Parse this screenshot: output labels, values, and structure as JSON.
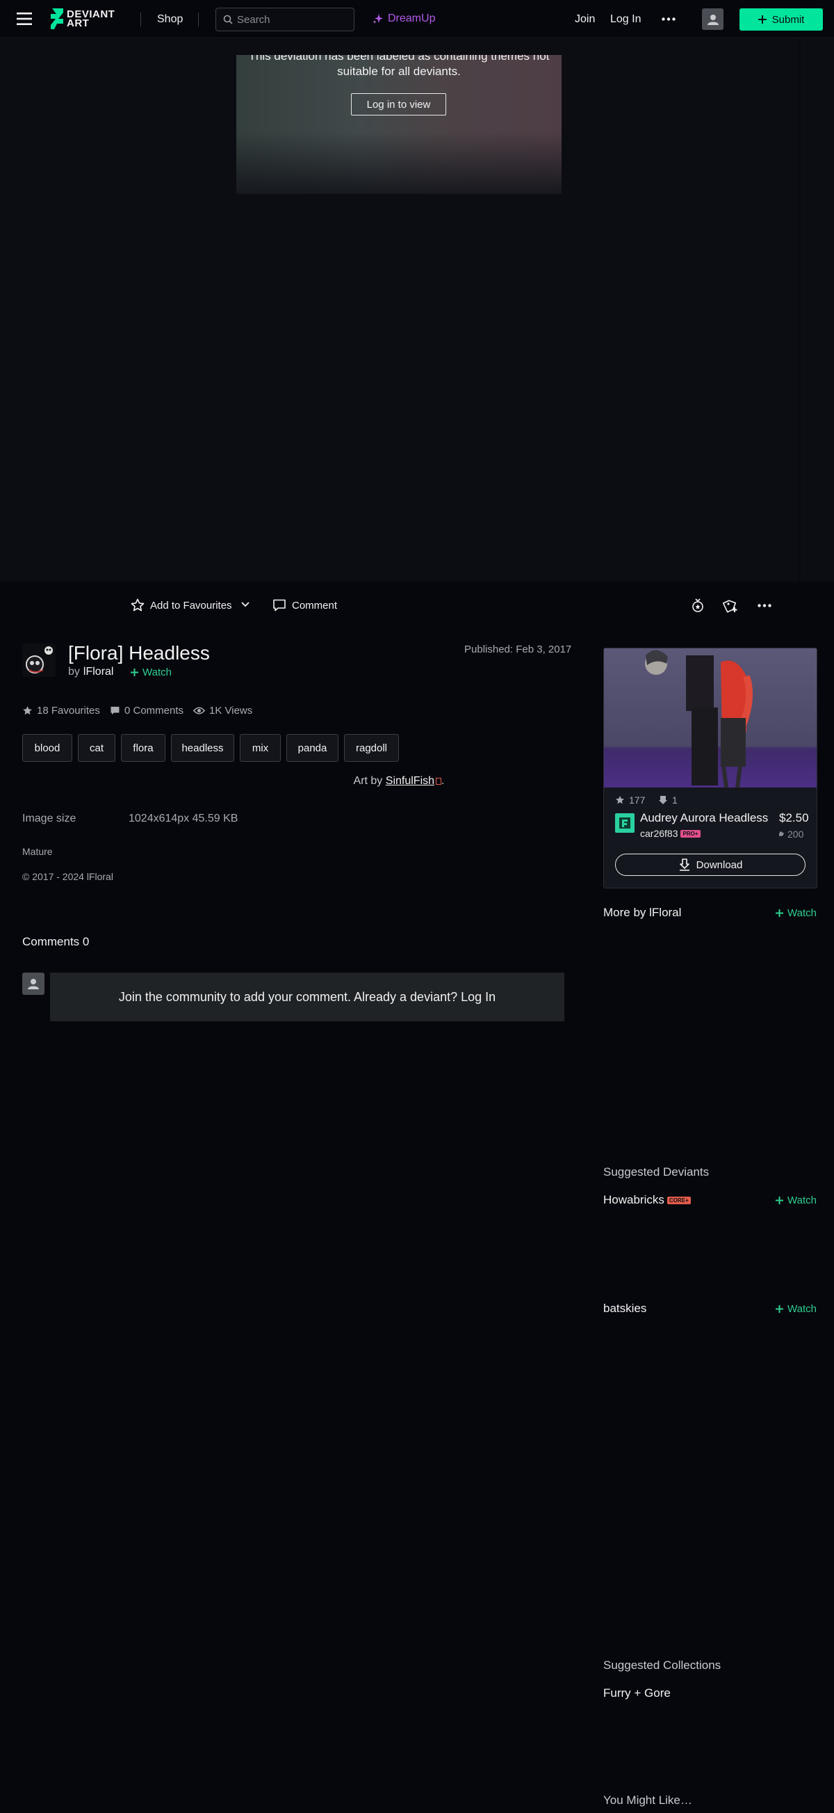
{
  "nav": {
    "brand_line1": "DEVIANT",
    "brand_line2": "ART",
    "shop": "Shop",
    "search_placeholder": "Search",
    "dreamup": "DreamUp",
    "join": "Join",
    "login": "Log In",
    "submit": "Submit"
  },
  "mature": {
    "line1": "This deviation has been labeled as containing themes not",
    "line2": "suitable for all deviants.",
    "button": "Log in to view"
  },
  "actions": {
    "add_fav": "Add to Favourites",
    "comment": "Comment"
  },
  "deviation": {
    "title": "[Flora] Headless",
    "by": "by",
    "author": "lFloral",
    "watch": "Watch",
    "published": "Published: Feb 3, 2017",
    "favourites": "18 Favourites",
    "comments": "0 Comments",
    "views": "1K Views",
    "tags": [
      "blood",
      "cat",
      "flora",
      "headless",
      "mix",
      "panda",
      "ragdoll"
    ],
    "art_by_prefix": "Art by",
    "art_by_name": "SinfulFish",
    "art_by_suffix": ".",
    "image_size_label": "Image size",
    "image_size_value": "1024x614px 45.59 KB",
    "mature_label": "Mature",
    "copyright": "© 2017 - 2024 lFloral"
  },
  "comments": {
    "header": "Comments 0",
    "prompt": "Join the community to add your comment. Already a deviant? Log In"
  },
  "sidebar": {
    "card": {
      "favs": "177",
      "downloads": "1",
      "title": "Audrey Aurora Headless",
      "price": "$2.50",
      "author": "car26f83",
      "author_badge": "PRO+",
      "points": "200",
      "download": "Download"
    },
    "more_by": "More by lFloral",
    "watch": "Watch",
    "suggested_deviants": "Suggested Deviants",
    "deviant1": "Howabricks",
    "deviant1_badge": "CORE+",
    "deviant2": "batskies",
    "suggested_collections": "Suggested Collections",
    "collection1": "Furry + Gore",
    "you_might_like": "You Might Like…"
  },
  "colors": {
    "background": "#06070d",
    "accent_green": "#00e59b",
    "watch_green": "#2fcf8f",
    "dreamup_purple": "#b35ae8"
  }
}
